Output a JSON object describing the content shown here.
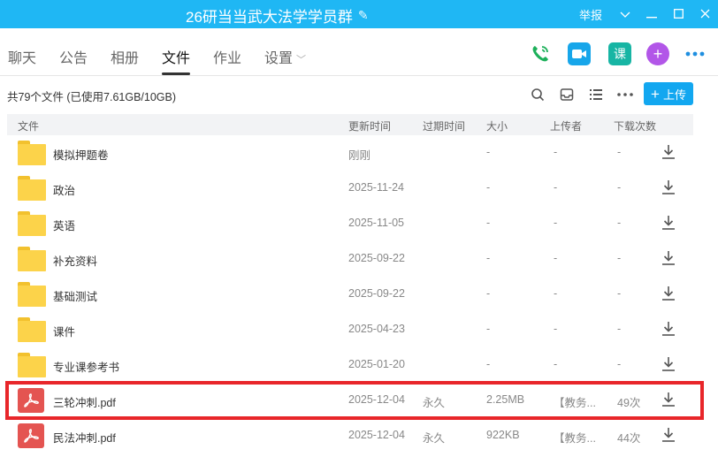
{
  "window": {
    "title": "26研当当武大法学学员群",
    "report": "举报"
  },
  "tabs": [
    {
      "label": "聊天"
    },
    {
      "label": "公告"
    },
    {
      "label": "相册"
    },
    {
      "label": "文件"
    },
    {
      "label": "作业"
    },
    {
      "label": "设置"
    }
  ],
  "toolbar": {
    "course_label": "课",
    "plus_label": "+"
  },
  "files": {
    "count_text": "共79个文件 (已使用7.61GB/10GB)",
    "upload_label": "上传",
    "columns": [
      "文件",
      "更新时间",
      "过期时间",
      "大小",
      "上传者",
      "下载次数"
    ],
    "rows": [
      {
        "type": "folder",
        "name": "模拟押题卷",
        "updated": "刚刚",
        "expires": "",
        "size": "-",
        "uploader": "-",
        "downloads": "-"
      },
      {
        "type": "folder",
        "name": "政治",
        "updated": "2025-11-24",
        "expires": "",
        "size": "-",
        "uploader": "-",
        "downloads": "-"
      },
      {
        "type": "folder",
        "name": "英语",
        "updated": "2025-11-05",
        "expires": "",
        "size": "-",
        "uploader": "-",
        "downloads": "-"
      },
      {
        "type": "folder",
        "name": "补充资料",
        "updated": "2025-09-22",
        "expires": "",
        "size": "-",
        "uploader": "-",
        "downloads": "-"
      },
      {
        "type": "folder",
        "name": "基础测试",
        "updated": "2025-09-22",
        "expires": "",
        "size": "-",
        "uploader": "-",
        "downloads": "-"
      },
      {
        "type": "folder",
        "name": "课件",
        "updated": "2025-04-23",
        "expires": "",
        "size": "-",
        "uploader": "-",
        "downloads": "-"
      },
      {
        "type": "folder",
        "name": "专业课参考书",
        "updated": "2025-01-20",
        "expires": "",
        "size": "-",
        "uploader": "-",
        "downloads": "-"
      },
      {
        "type": "pdf",
        "name": "三轮冲刺.pdf",
        "updated": "2025-12-04",
        "expires": "永久",
        "size": "2.25MB",
        "uploader": "【教务...",
        "downloads": "49次"
      },
      {
        "type": "pdf",
        "name": "民法冲刺.pdf",
        "updated": "2025-12-04",
        "expires": "永久",
        "size": "922KB",
        "uploader": "【教务...",
        "downloads": "44次"
      }
    ]
  },
  "colors": {
    "titlebar": "#1fb7f4",
    "accent": "#12a7f0",
    "highlight": "#e8262a",
    "folder": "#fcd34a",
    "pdf": "#e45451"
  }
}
